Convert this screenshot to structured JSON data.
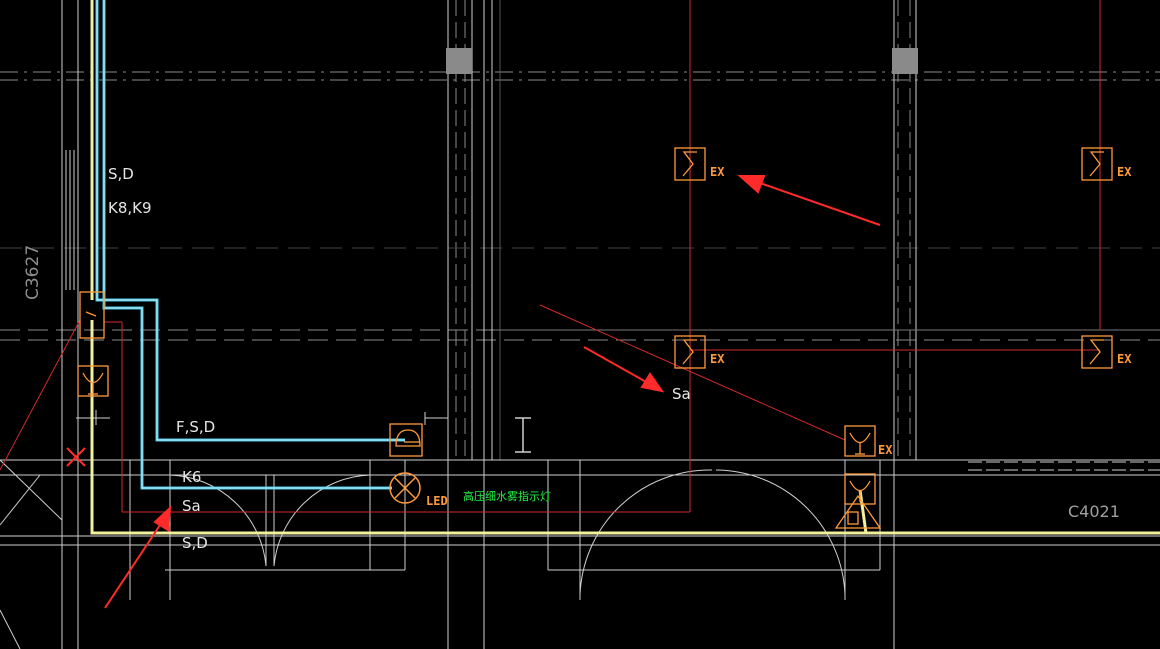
{
  "colors": {
    "background": "#000000",
    "wall": "#d7d7d7",
    "grid": "#9a9a9a",
    "red_wire": "#d42a2a",
    "cyan_wire": "#49c6e6",
    "yellow_wire": "#f1f09c",
    "symbol": "#ff9a3c",
    "arrow": "#ff2a2a",
    "led_note": "#22ee44"
  },
  "labels": {
    "c3627": "C3627",
    "c4021": "C4021",
    "sd_top": "S,D",
    "k8k9": "K8,K9",
    "fsd": "F,S,D",
    "k6": "K6",
    "sa_left": "Sa",
    "sd_bottom": "S,D",
    "sa_mid": "Sa",
    "led": "LED",
    "led_note": "高压细水雾指示灯",
    "ex": "EX"
  },
  "icons": [
    "exit-sign-icon",
    "speaker-icon",
    "alarm-bell-icon",
    "led-lamp-icon",
    "junction-box-icon",
    "cross-marker-icon",
    "annotation-arrow-icon",
    "column-icon"
  ]
}
